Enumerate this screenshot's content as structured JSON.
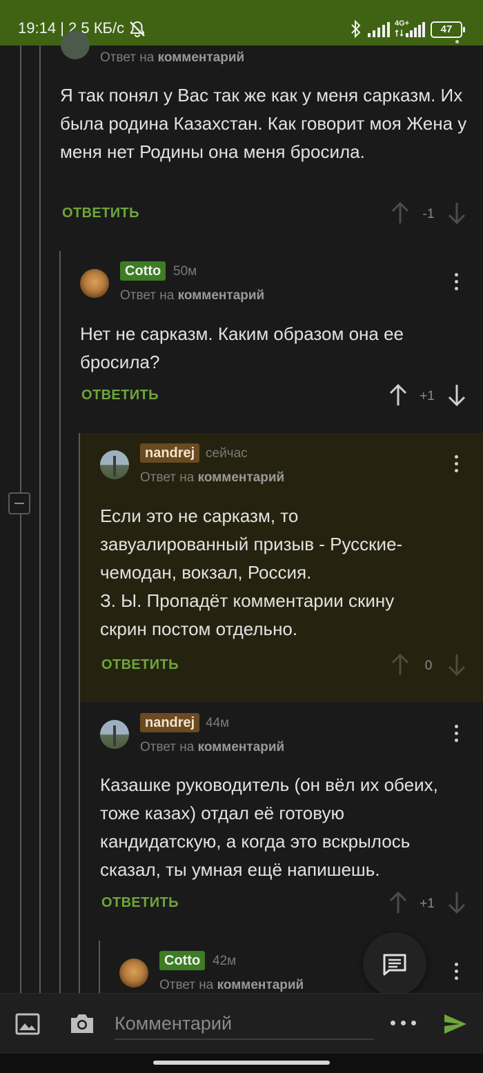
{
  "status_bar": {
    "time": "19:14",
    "speed": "2,5 КБ/с",
    "network": "4G+",
    "battery": "47"
  },
  "comments": [
    {
      "reply_to_prefix": "Ответ на",
      "reply_to_link": "комментарий",
      "text": "Я так понял у Вас так же как у меня сарказм. Их была родина Казахстан. Как говорит моя Жена у меня нет Родины она меня бросила.",
      "reply_label": "ОТВЕТИТЬ",
      "score": "-1"
    },
    {
      "author": "Cotto",
      "time": "50м",
      "reply_to_prefix": "Ответ на",
      "reply_to_link": "комментарий",
      "text": "Нет не сарказм. Каким образом она ее бросила?",
      "reply_label": "ОТВЕТИТЬ",
      "score": "+1"
    },
    {
      "author": "nandrej",
      "time": "сейчас",
      "reply_to_prefix": "Ответ на",
      "reply_to_link": "комментарий",
      "text_lines": [
        "Если это не сарказм, то",
        "завуалированный призыв - Русские-",
        "чемодан, вокзал, Россия.",
        "З. Ы. Пропадёт комментарии скину",
        "скрин постом отдельно."
      ],
      "reply_label": "ОТВЕТИТЬ",
      "score": "0"
    },
    {
      "author": "nandrej",
      "time": "44м",
      "reply_to_prefix": "Ответ на",
      "reply_to_link": "комментарий",
      "text": "Казашке руководитель (он вёл их обеих, тоже казах) отдал её готовую кандидатскую, а когда это вскрылось сказал, ты умная ещё напишешь.",
      "reply_label": "ОТВЕТИТЬ",
      "score": "+1"
    },
    {
      "author": "Cotto",
      "time": "42м",
      "reply_to_prefix": "Ответ на",
      "reply_to_link": "комментарий"
    }
  ],
  "composer": {
    "placeholder": "Комментарий"
  },
  "colors": {
    "accent_green": "#6fa63b",
    "status_bar": "#3f6313",
    "highlight_bg": "#25230f"
  },
  "icons": [
    "bluetooth-icon",
    "signal-icon",
    "battery-icon",
    "mute-icon",
    "image-icon",
    "camera-icon",
    "more-icon",
    "send-icon",
    "chat-icon",
    "collapse-icon",
    "upvote-icon",
    "downvote-icon",
    "kebab-icon"
  ]
}
